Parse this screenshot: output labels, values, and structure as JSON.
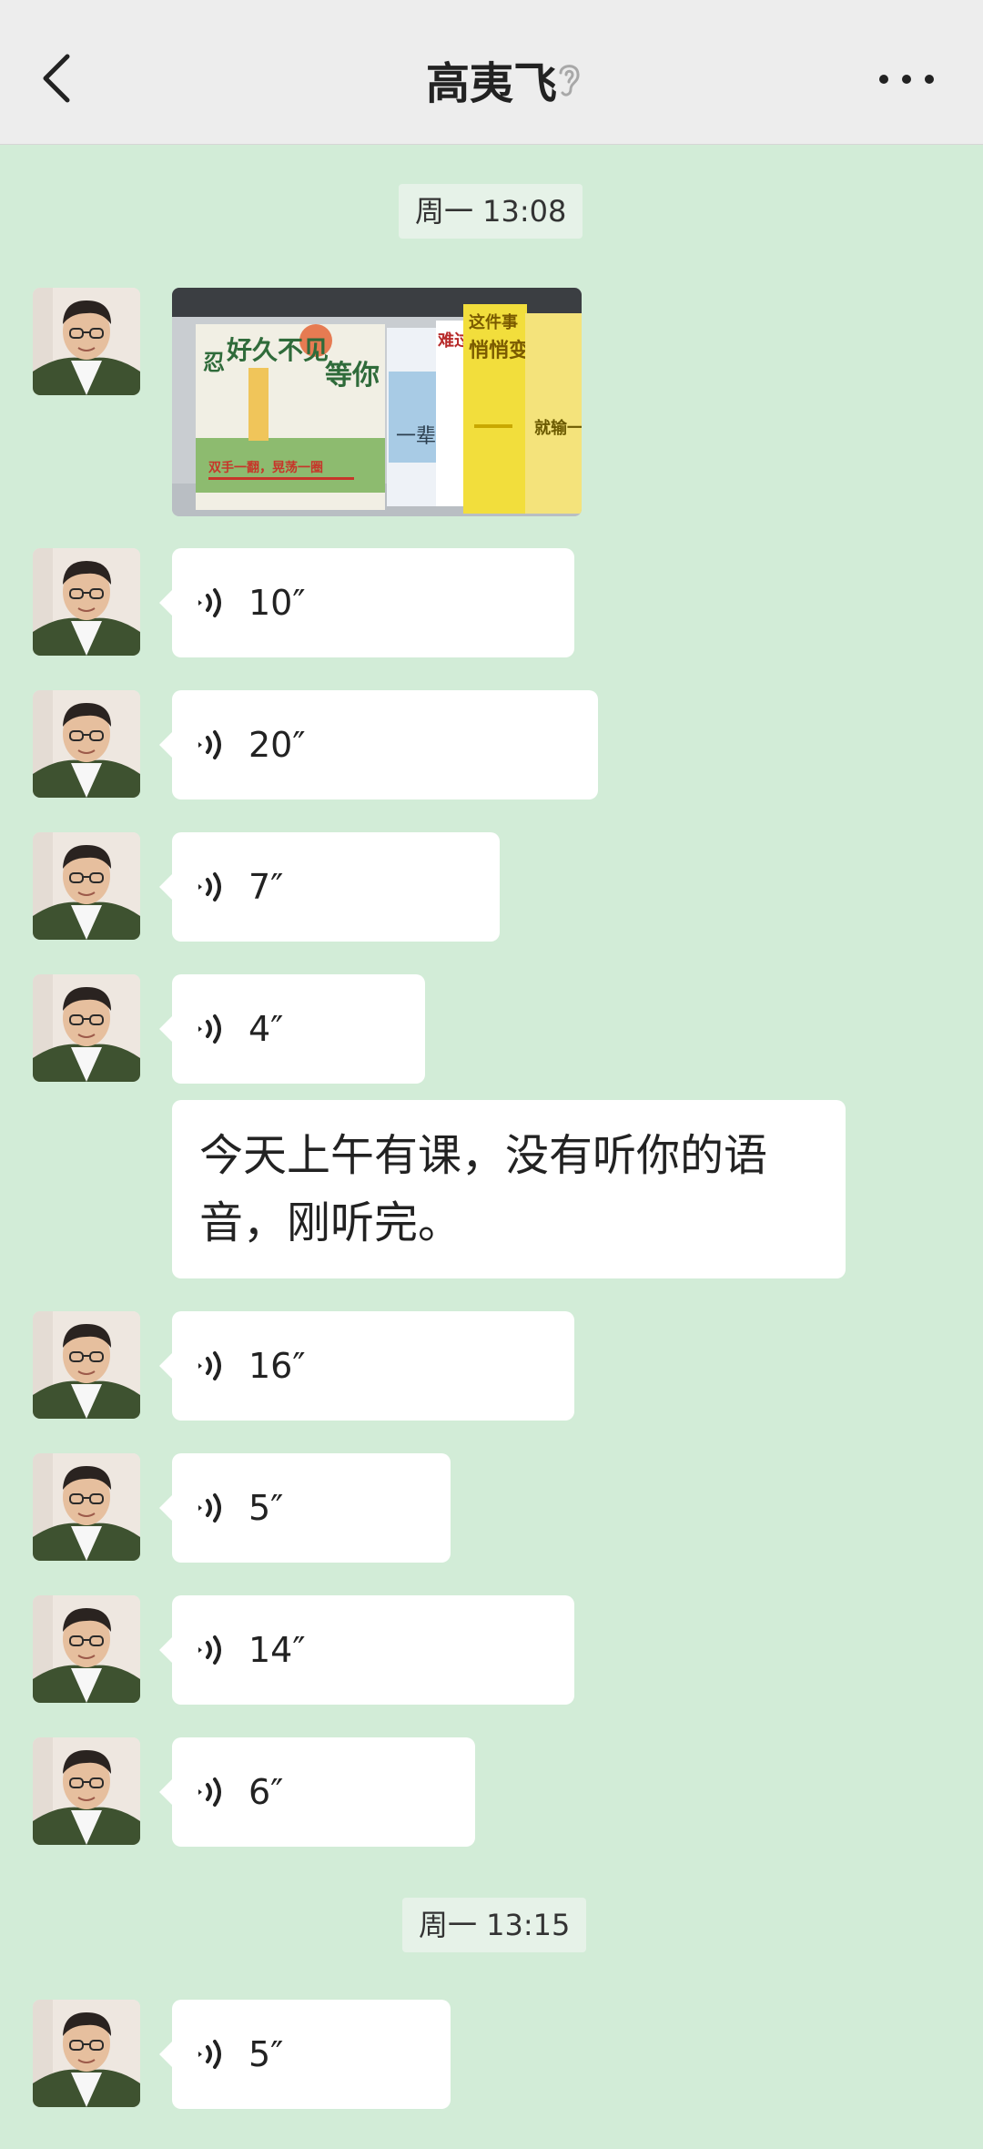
{
  "header": {
    "title": "高夷飞",
    "back_icon": "chevron-left-icon",
    "ear_icon": "ear-icon",
    "more_icon": "more-dots-icon"
  },
  "timestamps": [
    "周一 13:08",
    "周一 13:15"
  ],
  "messages": {
    "voice": [
      "10″",
      "20″",
      "7″",
      "4″",
      "16″",
      "5″",
      "14″",
      "6″",
      "5″"
    ],
    "text": "今天上午有课，没有听你的语音，刚听完。"
  },
  "image_text": {
    "book1": "好久不见",
    "book1_side": "忍",
    "book2": "等你",
    "book2_caption": "双手一翻，晃荡一圈",
    "book3": "一辈子吧",
    "book4": "难过我在",
    "book5": "悄悄变好",
    "book5_top": "这件事",
    "book6": "就输一会"
  },
  "colors": {
    "background": "#d2ecd7",
    "bubble": "#ffffff",
    "topbar": "#ededed"
  }
}
